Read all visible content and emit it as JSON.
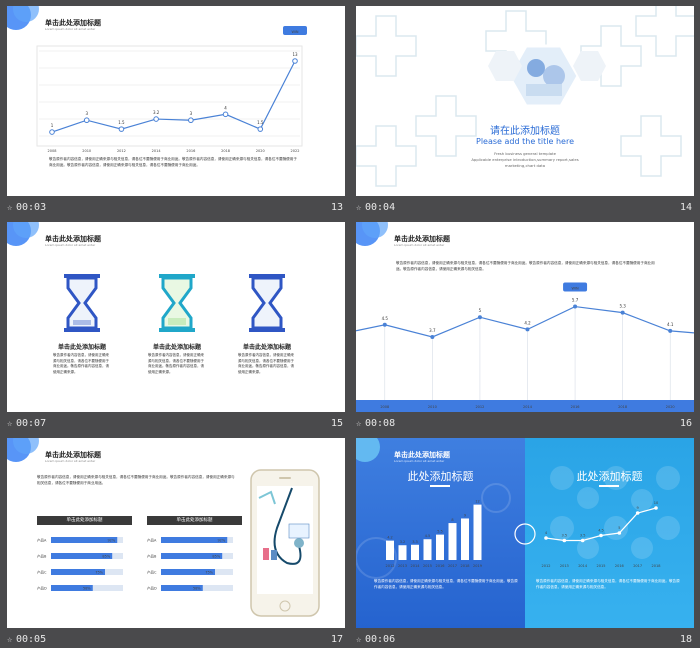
{
  "slides": [
    {
      "num": "13",
      "time": "00:03"
    },
    {
      "num": "14",
      "time": "00:04"
    },
    {
      "num": "15",
      "time": "00:07"
    },
    {
      "num": "16",
      "time": "00:08"
    },
    {
      "num": "17",
      "time": "00:05"
    },
    {
      "num": "18",
      "time": "00:06"
    }
  ],
  "common": {
    "title": "单击此处添加标题",
    "subtitle": "Lorem ipsum dolor sit amet enter"
  },
  "s13": {
    "badge": "WIN",
    "para": "敬告原作者内容信息，请使用正确来源与相关信息，请各位不要随便用于商业用途。敬告原作者内容信息，请使用正确来源与相关信息，请各位不要随便用于商业用途。敬告原作者内容信息，请使用正确来源与相关信息，请各位不要随便用于商业用途。"
  },
  "s14": {
    "title_cn": "请在此添加标题",
    "title_en": "Please add the title here",
    "desc1": "Fresh business general template",
    "desc2": "Applicable enterprise introduction,summary report,sales",
    "desc3": "marketing,chart data"
  },
  "s15": {
    "items": [
      {
        "title": "单击此处添加标题",
        "text": "敬告原作者内容信息，请使用正确来源与相关信息，请各位不要随便用于商业用途。敬告原作者内容信息，请使用正确来源。"
      },
      {
        "title": "单击此处添加标题",
        "text": "敬告原作者内容信息，请使用正确来源与相关信息，请各位不要随便用于商业用途。敬告原作者内容信息，请使用正确来源。"
      },
      {
        "title": "单击此处添加标题",
        "text": "敬告原作者内容信息，请使用正确来源与相关信息，请各位不要随便用于商业用途。敬告原作者内容信息，请使用正确来源。"
      }
    ]
  },
  "s16": {
    "badge": "WIN",
    "para": "敬告原作者内容信息，请使用正确来源与相关信息，请各位不要随便用于商业用途。敬告原作者内容信息，请使用正确来源与相关信息，请各位不要随便用于商业用途。敬告原作者内容信息，请使用正确来源与相关信息。"
  },
  "s17": {
    "para": "敬告原作者内容信息，请使用正确来源与相关信息，请各位不要随便用于商业用途。敬告原作者内容信息，请使用正确来源与相关信息，请各位不要随便用于商业用途。",
    "panels": [
      {
        "header": "单击此处添加标题",
        "rows": [
          {
            "label": "产品A",
            "value": "92%"
          },
          {
            "label": "产品B",
            "value": "85%"
          },
          {
            "label": "产品C",
            "value": "75%"
          },
          {
            "label": "产品D",
            "value": "58%"
          }
        ]
      },
      {
        "header": "单击此处添加标题",
        "rows": [
          {
            "label": "产品A",
            "value": "92%"
          },
          {
            "label": "产品B",
            "value": "85%"
          },
          {
            "label": "产品C",
            "value": "75%"
          },
          {
            "label": "产品D",
            "value": "58%"
          }
        ]
      }
    ]
  },
  "s18": {
    "left_title": "此处添加标题",
    "right_title": "此处添加标题",
    "para_left": "敬告原作者内容信息，请使用正确来源与相关信息，请各位不要随便用于商业用途。敬告原作者内容信息，请使用正确来源与相关信息。",
    "para_right": "敬告原作者内容信息，请使用正确来源与相关信息，请各位不要随便用于商业用途。敬告原作者内容信息，请使用正确来源与相关信息。"
  },
  "chart_data": [
    {
      "type": "line",
      "x": [
        "2008",
        "2010",
        "2012",
        "2014",
        "2016",
        "2018",
        "2020",
        "2022"
      ],
      "values": [
        1,
        3,
        1.5,
        3.2,
        3,
        4,
        1.5,
        13
      ],
      "badge": "WIN"
    },
    {
      "type": "line",
      "x": [
        "2008",
        "2010",
        "2012",
        "2014",
        "2016",
        "2018",
        "2020"
      ],
      "values": [
        4.5,
        3.7,
        5,
        4.2,
        5.7,
        5.3,
        4.1
      ],
      "badge": "WIN"
    },
    {
      "type": "bar",
      "x": [
        "2012",
        "2013",
        "2014",
        "2015",
        "2016",
        "2017",
        "2018",
        "2019"
      ],
      "values": [
        4.2,
        3.2,
        3.3,
        4.5,
        5.5,
        8,
        9,
        12
      ]
    },
    {
      "type": "line",
      "x": [
        "2012",
        "2013",
        "2014",
        "2015",
        "2016",
        "2017",
        "2018"
      ],
      "values": [
        4,
        3.5,
        3.5,
        4.5,
        5,
        9,
        10
      ]
    }
  ]
}
